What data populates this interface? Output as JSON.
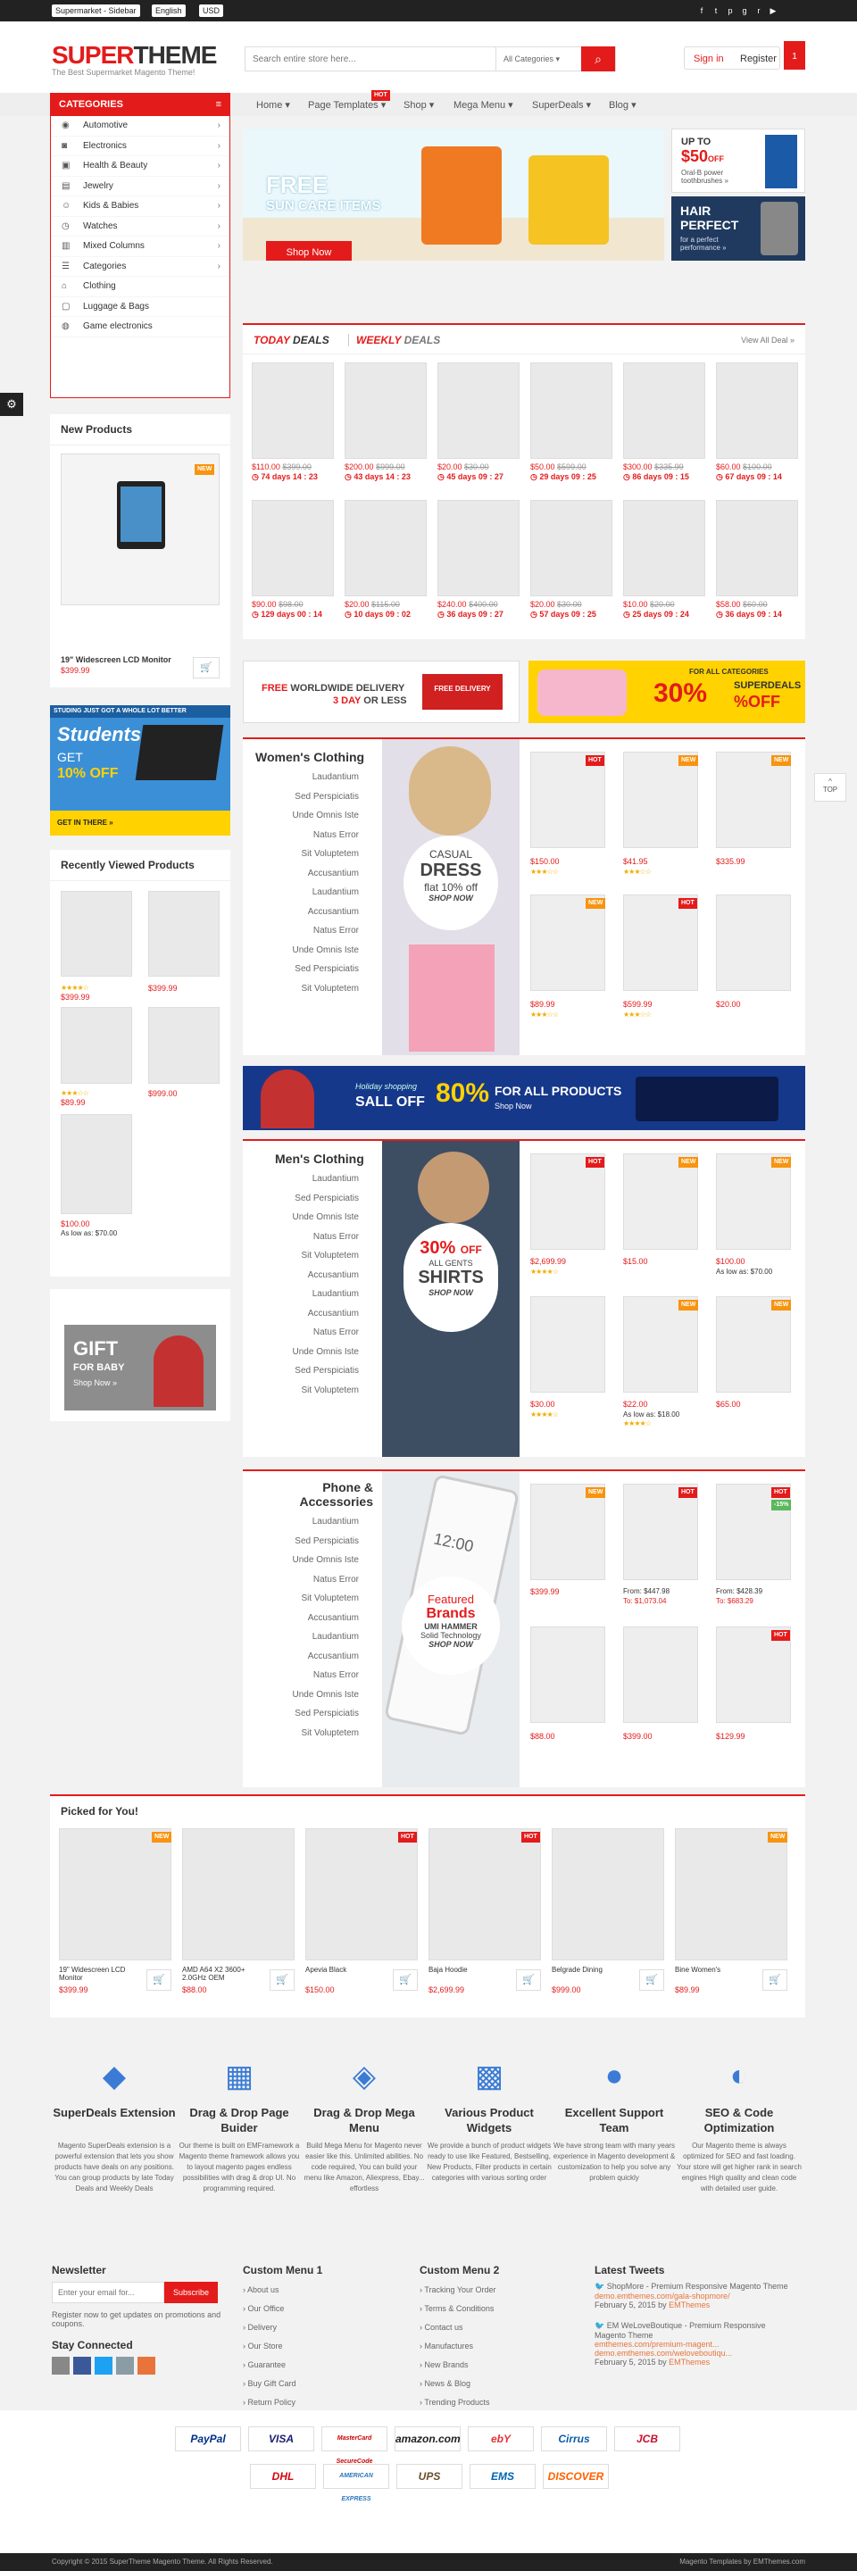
{
  "topbar": {
    "store_select": "Supermarket - Sidebar",
    "lang_select": "English",
    "currency_select": "USD"
  },
  "header": {
    "logo_left": "SUPER",
    "logo_right": "THEME",
    "tagline": "The Best Supermarket Magento Theme!",
    "search_placeholder": "Search entire store here...",
    "search_category": "All Categories",
    "signin": "Sign in",
    "register": "Register",
    "cart_count": "1"
  },
  "nav": {
    "categories": "CATEGORIES",
    "items": [
      "Home",
      "Page Templates",
      "Shop",
      "Mega Menu",
      "SuperDeals",
      "Blog"
    ],
    "hot": "HOT"
  },
  "categories": [
    "Automotive",
    "Electronics",
    "Health & Beauty",
    "Jewelry",
    "Kids & Babies",
    "Watches",
    "Mixed Columns",
    "Categories",
    "Clothing",
    "Luggage & Bags",
    "Game electronics"
  ],
  "sidebar": {
    "new_products": "New Products",
    "new_badge": "NEW",
    "new_name": "19\" Widescreen LCD Monitor",
    "new_price": "$399.99",
    "students_top": "STUDING JUST GOT A WHOLE LOT BETTER",
    "students_title": "Students",
    "students_get": "GET",
    "students_off": "10% OFF",
    "students_cta": "GET IN THERE »",
    "recent_title": "Recently Viewed Products",
    "recent": [
      {
        "price": "$399.99"
      },
      {
        "price": "$399.99"
      },
      {
        "price": "$89.99"
      },
      {
        "price": "$999.00"
      },
      {
        "price": "$100.00",
        "aslow": "As low as: $70.00"
      }
    ],
    "gift_title": "GIFT",
    "gift_sub": "FOR BABY",
    "gift_cta": "Shop Now »"
  },
  "hero": {
    "title": "FREE",
    "sub": "SUN CARE ITEMS",
    "cta": "Shop Now",
    "r1_top": "UP TO",
    "r1_amt": "$50",
    "r1_off": "OFF",
    "r1_desc": "Oral-B power toothbrushes »",
    "r2_t1": "HAIR",
    "r2_t2": "PERFECT",
    "r2_desc": "for a perfect performance »"
  },
  "deals": {
    "today": "TODAY",
    "deals1": "DEALS",
    "weekly": "WEEKLY",
    "deals2": "DEALS",
    "viewall": "View All Deal »",
    "row1": [
      {
        "p": "$110.00",
        "o": "$399.00",
        "t": "74 days 14 : 23"
      },
      {
        "p": "$200.00",
        "o": "$999.00",
        "t": "43 days 14 : 23"
      },
      {
        "p": "$20.00",
        "o": "$30.00",
        "t": "45 days 09 : 27"
      },
      {
        "p": "$50.00",
        "o": "$599.00",
        "t": "29 days 09 : 25"
      },
      {
        "p": "$300.00",
        "o": "$335.99",
        "t": "86 days 09 : 15"
      },
      {
        "p": "$60.00",
        "o": "$100.00",
        "t": "67 days 09 : 14"
      }
    ],
    "row2": [
      {
        "p": "$90.00",
        "o": "$98.00",
        "t": "129 days 00 : 14"
      },
      {
        "p": "$20.00",
        "o": "$115.00",
        "t": "10 days 09 : 02"
      },
      {
        "p": "$240.00",
        "o": "$400.00",
        "t": "36 days 09 : 27"
      },
      {
        "p": "$20.00",
        "o": "$30.00",
        "t": "57 days 09 : 25"
      },
      {
        "p": "$10.00",
        "o": "$20.00",
        "t": "25 days 09 : 24"
      },
      {
        "p": "$58.00",
        "o": "$60.00",
        "t": "36 days 09 : 14"
      }
    ]
  },
  "promo": {
    "free": "FREE",
    "rest": "WORLDWIDE DELIVERY",
    "days": "3 DAY",
    "orless": "OR LESS",
    "truck": "FREE DELIVERY",
    "forall": "FOR ALL CATEGORIES",
    "pct": "30%",
    "superdeals": "SUPERDEALS",
    "off": "%OFF"
  },
  "women": {
    "title": "Women's Clothing",
    "links": [
      "Laudantium",
      "Sed Perspiciatis",
      "Unde Omnis Iste",
      "Natus Error",
      "Sit Voluptetem",
      "Accusantium",
      "Laudantium",
      "Accusantium",
      "Natus Error",
      "Unde Omnis Iste",
      "Sed Perspiciatis",
      "Sit Voluptetem"
    ],
    "banner_l1": "CASUAL",
    "banner_l2": "DRESS",
    "banner_l3": "flat 10% off",
    "banner_l4": "SHOP NOW",
    "prices": [
      "$150.00",
      "$41.95",
      "$335.99",
      "$89.99",
      "$599.99",
      "$20.00"
    ]
  },
  "wide": {
    "holiday": "Holiday shopping",
    "saleoff": "SALL OFF",
    "pct": "80%",
    "forall": "FOR ALL PRODUCTS",
    "shop": "Shop Now"
  },
  "men": {
    "title": "Men's Clothing",
    "links": [
      "Laudantium",
      "Sed Perspiciatis",
      "Unde Omnis Iste",
      "Natus Error",
      "Sit Voluptetem",
      "Accusantium",
      "Laudantium",
      "Accusantium",
      "Natus Error",
      "Unde Omnis Iste",
      "Sed Perspiciatis",
      "Sit Voluptetem"
    ],
    "banner_l1": "30%",
    "banner_l2": "OFF",
    "banner_l3": "ALL GENTS",
    "banner_l4": "SHIRTS",
    "banner_l5": "SHOP NOW",
    "prices": [
      "$2,699.99",
      "$15.00",
      "$100.00",
      "$30.00",
      "$22.00",
      "$65.00"
    ],
    "aslow1": "As low as: $70.00",
    "aslow2": "As low as: $18.00"
  },
  "phone": {
    "title1": "Phone &",
    "title2": "Accessories",
    "links": [
      "Laudantium",
      "Sed Perspiciatis",
      "Unde Omnis Iste",
      "Natus Error",
      "Sit Voluptetem",
      "Accusantium",
      "Laudantium",
      "Accusantium",
      "Natus Error",
      "Unde Omnis Iste",
      "Sed Perspiciatis",
      "Sit Voluptetem"
    ],
    "b1": "Featured",
    "b2": "Brands",
    "b3": "UMI HAMMER",
    "b4": "Solid Technology",
    "b5": "SHOP NOW",
    "prices": [
      "$399.99",
      "$88.00",
      "$399.00",
      "$129.99"
    ],
    "from1": "From: $447.98",
    "to1": "To: $1,073.04",
    "from2": "From: $428.39",
    "to2": "To: $683.29",
    "screen": "12:00"
  },
  "picked": {
    "title": "Picked for You!",
    "items": [
      {
        "name": "19\" Widescreen LCD Monitor",
        "price": "$399.99",
        "badge": "NEW"
      },
      {
        "name": "AMD A64 X2 3600+ 2.0GHz OEM",
        "price": "$88.00",
        "badge": ""
      },
      {
        "name": "Apevia Black",
        "price": "$150.00",
        "badge": "HOT"
      },
      {
        "name": "Baja Hoodie",
        "price": "$2,699.99",
        "badge": "HOT"
      },
      {
        "name": "Belgrade Dining",
        "price": "$999.00",
        "badge": ""
      },
      {
        "name": "Bine Women's",
        "price": "$89.99",
        "badge": "NEW"
      }
    ]
  },
  "features": [
    {
      "t": "SuperDeals Extension",
      "d": "Magento SuperDeals extension is a powerful extension that lets you show products have deals on any positions. You can group products by late Today Deals and Weekly Deals"
    },
    {
      "t": "Drag & Drop Page Buider",
      "d": "Our theme is built on EMFramework a Magento theme framework allows you to layout magento pages endless possibilities with drag & drop UI. No programming required."
    },
    {
      "t": "Drag & Drop Mega Menu",
      "d": "Build Mega Menu for Magento never easier like this. Unlimited abilities. No code required, You can build your menu like Amazon, Aliexpress, Ebay... effortless"
    },
    {
      "t": "Various Product Widgets",
      "d": "We provide a bunch of product widgets ready to use like Featured, Bestselling, New Products, Filter products in certain categories with various sorting order"
    },
    {
      "t": "Excellent Support Team",
      "d": "We have strong team with many years experience in Magento development & customization to help you solve any problem quickly"
    },
    {
      "t": "SEO & Code Optimization",
      "d": "Our Magento theme is always optimized for SEO and fast loading. Your store will get higher rank in search engines High quality and clean code with detailed user guide."
    }
  ],
  "footer": {
    "newsletter": "Newsletter",
    "nl_placeholder": "Enter your email for...",
    "subscribe": "Subscribe",
    "nl_desc": "Register now to get updates on promotions and coupons.",
    "stay": "Stay Connected",
    "menu1": "Custom Menu 1",
    "menu1_items": [
      "About us",
      "Our Office",
      "Delivery",
      "Our Store",
      "Guarantee",
      "Buy Gift Card",
      "Return Policy"
    ],
    "menu2": "Custom Menu 2",
    "menu2_items": [
      "Tracking Your Order",
      "Terms & Conditions",
      "Contact us",
      "Manufactures",
      "New Brands",
      "News & Blog",
      "Trending Products"
    ],
    "tweets": "Latest Tweets",
    "tw1": "ShopMore - Premium Responsive Magento Theme",
    "tw1l": "demo.emthemes.com/gala-shopmore/",
    "tw1d": "February 5, 2015",
    "tw1by": "EMThemes",
    "tw2": "EM WeLoveBoutique - Premium Responsive Magento Theme",
    "tw2l": "emthemes.com/premium-magent...",
    "tw2l2": "demo.emthemes.com/weloveboutiqu...",
    "tw2d": "February 5, 2015",
    "tw2by": "EMThemes",
    "by": "by"
  },
  "payments": [
    "PayPal",
    "VISA",
    "MasterCard SecureCode",
    "amazon.com",
    "ebY",
    "Cirrus",
    "JCB",
    "DHL",
    "AMERICAN EXPRESS",
    "UPS",
    "EMS",
    "DISCOVER"
  ],
  "copyright": "Copyright © 2015 SuperTheme Magento Theme. All Rights Reserved.",
  "credit": "Magento Templates by EMThemes.com",
  "totop": "TOP"
}
